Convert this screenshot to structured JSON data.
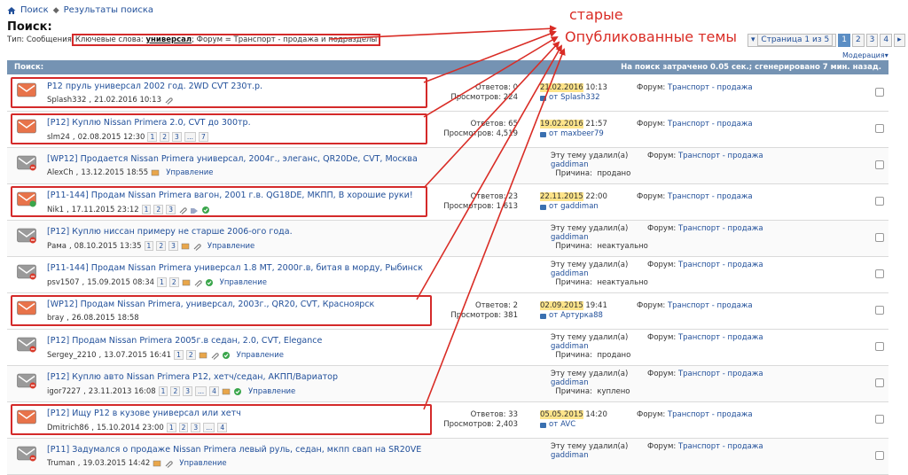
{
  "breadcrumb": {
    "home": "Поиск",
    "current": "Результаты поиска"
  },
  "page_title": "Поиск:",
  "search_type": {
    "prefix": "Тип: Сообщения",
    "kw_label": "Ключевые слова:",
    "keyword": "универсал",
    "forum_part": "; Форум = Транспорт - продажа и подразделы"
  },
  "annotations": {
    "line1": "старые",
    "line2": "Опубликованные темы"
  },
  "pagination": {
    "label": "Страница 1 из 5",
    "pages": [
      "1",
      "2",
      "3",
      "4"
    ],
    "next": "▸"
  },
  "moderation": "Модерация",
  "bar": {
    "left": "Поиск:",
    "right": "На поиск затрачено 0.05 сек.; сгенерировано 7 мин. назад."
  },
  "labels": {
    "replies": "Ответов:",
    "views": "Просмотров:",
    "from": "от",
    "forum": "Форум:",
    "deleted": "Эту тему удалил(а)",
    "reason": "Причина:"
  },
  "rows": [
    {
      "title": "P12 пруль универсал 2002 год. 2WD CVT 230т.р.",
      "author": "Splash332",
      "date": "21.02.2016 10:13",
      "pages": [],
      "manage": "",
      "replies": "0",
      "views": "224",
      "last_date": "21.02.2016",
      "last_time": "10:13",
      "last_user": "Splash332",
      "forum": "Транспорт - продажа",
      "highlight": true
    },
    {
      "title": "[P12] Куплю Nissan Primera 2.0, CVT до 300тр.",
      "author": "slm24",
      "date": "02.08.2015 12:30",
      "pages": [
        "1",
        "2",
        "3",
        "...",
        "7"
      ],
      "manage": "",
      "replies": "65",
      "views": "4,519",
      "last_date": "19.02.2016",
      "last_time": "21:57",
      "last_user": "maxbeer79",
      "forum": "Транспорт - продажа",
      "highlight": true
    },
    {
      "title": "[WP12] Продается Nissan Primera универсал, 2004г., элеганс, QR20De, CVT, Москва",
      "author": "AlexCh",
      "date": "13.12.2015 18:55",
      "pages": [],
      "manage": "Управление",
      "deleted_by": "gaddiman",
      "reason": "продано",
      "forum": "Транспорт - продажа",
      "highlight": false
    },
    {
      "title": "[P11-144] Продам Nissan Primera вагон, 2001 г.в. QG18DE, МКПП, В хорошие руки!",
      "author": "Nik1",
      "date": "17.11.2015 23:12",
      "pages": [
        "1",
        "2",
        "3"
      ],
      "manage": "",
      "replies": "23",
      "views": "1,613",
      "last_date": "22.11.2015",
      "last_time": "22:00",
      "last_user": "gaddiman",
      "forum": "Транспорт - продажа",
      "highlight": true
    },
    {
      "title": "[P12] Куплю ниссан примеру не старше 2006-ого года.",
      "author": "Рама",
      "date": "08.10.2015 13:35",
      "pages": [
        "1",
        "2",
        "3"
      ],
      "manage": "Управление",
      "deleted_by": "gaddiman",
      "reason": "неактуально",
      "forum": "Транспорт - продажа",
      "highlight": false
    },
    {
      "title": "[P11-144] Продам Nissan Primera универсал 1.8 MT, 2000г.в, битая в морду, Рыбинск",
      "author": "psv1507",
      "date": "15.09.2015 08:34",
      "pages": [
        "1",
        "2"
      ],
      "manage": "Управление",
      "deleted_by": "gaddiman",
      "reason": "неактуально",
      "forum": "Транспорт - продажа",
      "highlight": false
    },
    {
      "title": "[WP12] Продам Nissan Primera, универсал, 2003г., QR20, CVT, Красноярск",
      "author": "bray",
      "date": "26.08.2015 18:58",
      "pages": [],
      "manage": "",
      "replies": "2",
      "views": "381",
      "last_date": "02.09.2015",
      "last_time": "19:41",
      "last_user": "Артурка88",
      "forum": "Транспорт - продажа",
      "highlight": true
    },
    {
      "title": "[P12] Продам Nissan Primera 2005г.в седан, 2.0, CVT, Elegance",
      "author": "Sergey_2210",
      "date": "13.07.2015 16:41",
      "pages": [
        "1",
        "2"
      ],
      "manage": "Управление",
      "deleted_by": "gaddiman",
      "reason": "продано",
      "forum": "Транспорт - продажа",
      "highlight": false
    },
    {
      "title": "[P12] Куплю авто Nissan Primera P12, хетч/седан, АКПП/Вариатор",
      "author": "igor7227",
      "date": "23.11.2013 16:08",
      "pages": [
        "1",
        "2",
        "3",
        "...",
        "4"
      ],
      "manage": "Управление",
      "deleted_by": "gaddiman",
      "reason": "куплено",
      "forum": "Транспорт - продажа",
      "highlight": false
    },
    {
      "title": "[P12] Ищу P12 в кузове универсал или хетч",
      "author": "Dmitrich86",
      "date": "15.10.2014 23:00",
      "pages": [
        "1",
        "2",
        "3",
        "...",
        "4"
      ],
      "manage": "",
      "replies": "33",
      "views": "2,403",
      "last_date": "05.05.2015",
      "last_time": "14:20",
      "last_user": "AVC",
      "forum": "Транспорт - продажа",
      "highlight": true
    },
    {
      "title": "[P11] Задумался о продаже Nissan Primera левый руль, седан, мкпп свап на SR20VE",
      "author": "Truman",
      "date": "19.03.2015 14:42",
      "pages": [],
      "manage": "Управление",
      "deleted_by": "gaddiman",
      "reason": "",
      "forum": "Транспорт - продажа",
      "highlight": false
    }
  ],
  "colors": {
    "annotation": "#d92c25",
    "highlight": "#fde48a",
    "bar": "#7593b3",
    "link": "#22509a",
    "envelope_new": "#e8734a",
    "envelope_old": "#9a9a9a"
  }
}
